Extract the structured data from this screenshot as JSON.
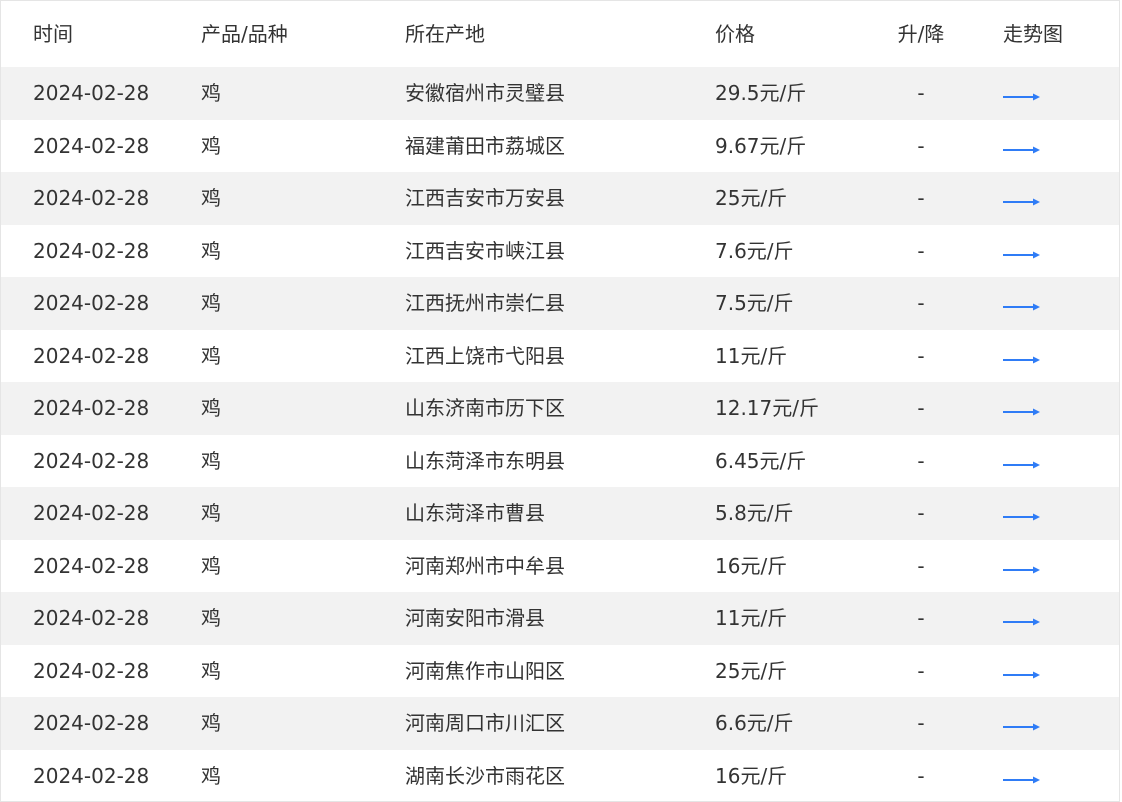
{
  "table": {
    "headers": {
      "time": "时间",
      "product": "产品/品种",
      "place": "所在产地",
      "price": "价格",
      "change": "升/降",
      "trend": "走势图"
    },
    "rows": [
      {
        "time": "2024-02-28",
        "product": "鸡",
        "place": "安徽宿州市灵璧县",
        "price": "29.5元/斤",
        "change": "-"
      },
      {
        "time": "2024-02-28",
        "product": "鸡",
        "place": "福建莆田市荔城区",
        "price": "9.67元/斤",
        "change": "-"
      },
      {
        "time": "2024-02-28",
        "product": "鸡",
        "place": "江西吉安市万安县",
        "price": "25元/斤",
        "change": "-"
      },
      {
        "time": "2024-02-28",
        "product": "鸡",
        "place": "江西吉安市峡江县",
        "price": "7.6元/斤",
        "change": "-"
      },
      {
        "time": "2024-02-28",
        "product": "鸡",
        "place": "江西抚州市崇仁县",
        "price": "7.5元/斤",
        "change": "-"
      },
      {
        "time": "2024-02-28",
        "product": "鸡",
        "place": "江西上饶市弋阳县",
        "price": "11元/斤",
        "change": "-"
      },
      {
        "time": "2024-02-28",
        "product": "鸡",
        "place": "山东济南市历下区",
        "price": "12.17元/斤",
        "change": "-"
      },
      {
        "time": "2024-02-28",
        "product": "鸡",
        "place": "山东菏泽市东明县",
        "price": "6.45元/斤",
        "change": "-"
      },
      {
        "time": "2024-02-28",
        "product": "鸡",
        "place": "山东菏泽市曹县",
        "price": "5.8元/斤",
        "change": "-"
      },
      {
        "time": "2024-02-28",
        "product": "鸡",
        "place": "河南郑州市中牟县",
        "price": "16元/斤",
        "change": "-"
      },
      {
        "time": "2024-02-28",
        "product": "鸡",
        "place": "河南安阳市滑县",
        "price": "11元/斤",
        "change": "-"
      },
      {
        "time": "2024-02-28",
        "product": "鸡",
        "place": "河南焦作市山阳区",
        "price": "25元/斤",
        "change": "-"
      },
      {
        "time": "2024-02-28",
        "product": "鸡",
        "place": "河南周口市川汇区",
        "price": "6.6元/斤",
        "change": "-"
      },
      {
        "time": "2024-02-28",
        "product": "鸡",
        "place": "湖南长沙市雨花区",
        "price": "16元/斤",
        "change": "-"
      }
    ]
  },
  "colors": {
    "stripe": "#f2f2f2",
    "trend_arrow": "#2f7cf6",
    "text": "#333333"
  },
  "icons": {
    "trend": "trend-arrow-right-icon"
  }
}
